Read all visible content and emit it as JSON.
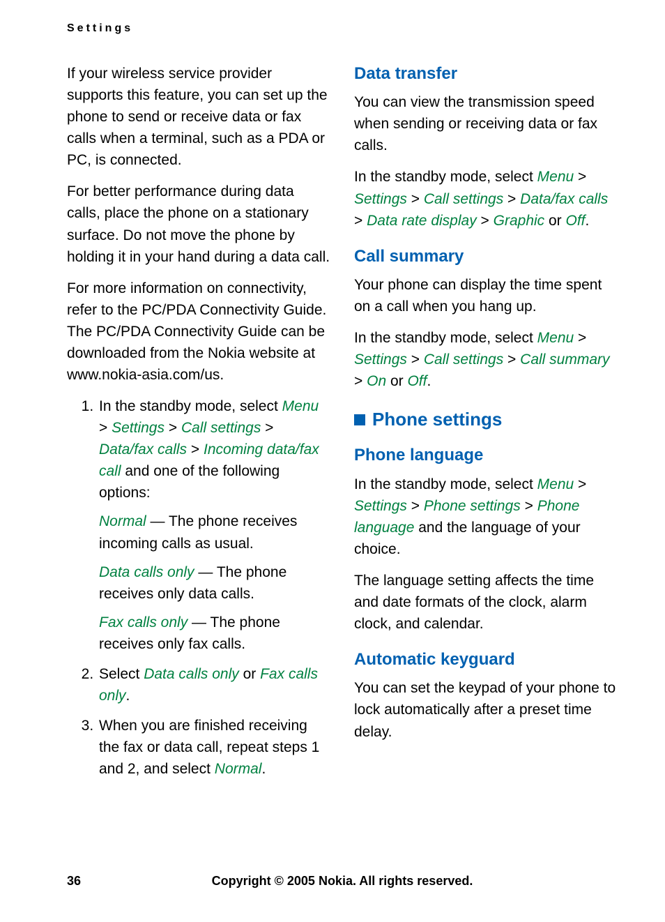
{
  "header": {
    "running_head": "Settings"
  },
  "left": {
    "p1": "If your wireless service provider supports this feature, you can set up the phone to send or receive data or fax calls when a terminal, such as a PDA or PC, is connected.",
    "p2": "For better performance during data calls, place the phone on a stationary surface. Do not move the phone by holding it in your hand during a data call.",
    "p3": "For more information on connectivity, refer to the PC/PDA Connectivity Guide. The PC/PDA Connectivity Guide can be downloaded from the Nokia website at www.nokia-asia.com/us.",
    "li1": {
      "pre": "In the standby mode, select ",
      "path": [
        "Menu",
        "Settings",
        "Call settings",
        "Data/fax calls",
        "Incoming data/fax call"
      ],
      "post": " and one of the following options:",
      "opts": [
        {
          "name": "Normal",
          "desc": " — The phone receives incoming calls as usual."
        },
        {
          "name": "Data calls only",
          "desc": " — The phone receives only data calls."
        },
        {
          "name": "Fax calls only",
          "desc": " — The phone receives only fax calls."
        }
      ]
    },
    "li2": {
      "pre": "Select ",
      "a": "Data calls only",
      "mid": " or ",
      "b": "Fax calls only",
      "post": "."
    },
    "li3": {
      "pre": "When you are finished receiving the fax or data call, repeat steps 1 and 2, and select ",
      "a": "Normal",
      "post": "."
    }
  },
  "right": {
    "data_transfer": {
      "title": "Data transfer",
      "p1": "You can view the transmission speed when sending or receiving data or fax calls.",
      "p2": {
        "pre": "In the standby mode, select ",
        "path": [
          "Menu",
          "Settings",
          "Call settings",
          "Data/fax calls",
          "Data rate display"
        ],
        "opt1": "Graphic",
        "mid": " or ",
        "opt2": "Off",
        "post": "."
      }
    },
    "call_summary": {
      "title": "Call summary",
      "p1": "Your phone can display the time spent on a call when you hang up.",
      "p2": {
        "pre": "In the standby mode, select ",
        "path": [
          "Menu",
          "Settings",
          "Call settings",
          "Call summary"
        ],
        "opt1": "On",
        "mid": " or ",
        "opt2": "Off",
        "post": "."
      }
    },
    "phone_settings": {
      "title": "Phone settings"
    },
    "phone_language": {
      "title": "Phone language",
      "p1": {
        "pre": "In the standby mode, select ",
        "path": [
          "Menu",
          "Settings",
          "Phone settings",
          "Phone language"
        ],
        "post": " and the language of your choice."
      },
      "p2": "The language setting affects the time and date formats of the clock, alarm clock, and calendar."
    },
    "auto_keyguard": {
      "title": "Automatic keyguard",
      "p1": "You can set the keypad of your phone to lock automatically after a preset time delay."
    }
  },
  "footer": {
    "page": "36",
    "copyright": "Copyright © 2005 Nokia. All rights reserved."
  },
  "sep": " > "
}
